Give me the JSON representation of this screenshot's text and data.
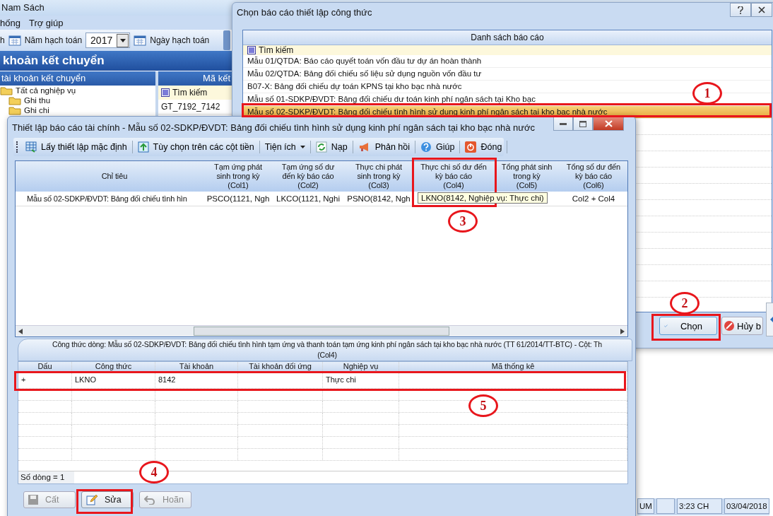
{
  "app": {
    "title": "Nam Sách",
    "menu": [
      "hống",
      "Trợ giúp"
    ],
    "toolbar": {
      "first_label": "h",
      "year_label": "Năm hạch toán",
      "year_value": "2017",
      "date_label": "Ngày hạch toán"
    },
    "heading": "khoản kết chuyển",
    "tree_panel": {
      "title": "tài khoản kết chuyển",
      "items": [
        {
          "label": "Tất cả nghiệp vụ",
          "children": [
            {
              "label": "Ghi thu"
            },
            {
              "label": "Ghi chi"
            }
          ]
        }
      ]
    },
    "grid": {
      "column": "Mã kết",
      "search": "Tìm kiếm",
      "rows": [
        "GT_7192_7142"
      ]
    },
    "status_bar": [
      "UM",
      "3:23 CH",
      "03/04/2018"
    ]
  },
  "report_picker": {
    "title": "Chọn báo cáo thiết lập công thức",
    "list_header": "Danh sách báo cáo",
    "search": "Tìm kiếm",
    "items": [
      {
        "label": "Mẫu 01/QTDA: Báo cáo quyết toán vốn đầu tư dự án hoàn thành",
        "selected": false
      },
      {
        "label": "Mẫu 02/QTDA: Bảng đối chiếu số liệu sử dụng nguồn vốn đầu tư",
        "selected": false
      },
      {
        "label": "B07-X: Bảng đối chiếu dự toán KPNS tại kho bạc nhà nước",
        "selected": false
      },
      {
        "label": "Mẫu số 01-SDKP/ĐVDT: Bảng đối chiếu dư toán kinh phí ngân sách tại Kho bạc",
        "selected": false
      },
      {
        "label": "Mẫu số 02-SDKP/ĐVDT: Bảng đối chiếu tình hình sử dụng kinh phí ngân sách tại kho bạc nhà nước",
        "selected": true
      }
    ],
    "buttons": [
      {
        "label": "Chọn",
        "kind": "ok"
      },
      {
        "label": "Hủy b",
        "kind": "cancel"
      }
    ]
  },
  "setup_dialog": {
    "title": "Thiết lập báo cáo tài chính - Mẫu số 02-SDKP/ĐVDT: Bảng đối chiếu tình hình sử dụng kinh phí ngân sách tại kho bạc nhà nước",
    "toolbar": [
      {
        "label": "Lấy thiết lập mặc định",
        "kind": "default"
      },
      {
        "label": "Tùy chọn trên các cột tiền",
        "kind": "options"
      },
      {
        "label": "Tiện ích",
        "kind": "menu"
      },
      {
        "label": "Nạp",
        "kind": "reload"
      },
      {
        "label": "Phản hồi",
        "kind": "feedback"
      },
      {
        "label": "Giúp",
        "kind": "help"
      },
      {
        "label": "Đóng",
        "kind": "close"
      }
    ],
    "columns": [
      {
        "label": "Chỉ tiêu"
      },
      {
        "label": "Tạm ứng phát sinh trong kỳ",
        "code": "(Col1)"
      },
      {
        "label": "Tạm ứng số dư đến kỳ báo cáo",
        "code": "(Col2)"
      },
      {
        "label": "Thực chi phát sinh trong kỳ",
        "code": "(Col3)"
      },
      {
        "label": "Thực chi số dư đến kỳ báo cáo",
        "code": "(Col4)"
      },
      {
        "label": "Tổng phát sinh trong kỳ",
        "code": "(Col5)"
      },
      {
        "label": "Tổng số dư đến kỳ báo cáo",
        "code": "(Col6)"
      }
    ],
    "rows": [
      {
        "label": "Mẫu số 02-SDKP/ĐVDT: Bảng đối chiếu tình hìn",
        "values": [
          "PSCO(1121, Ngh",
          "LKCO(1121, Nghi",
          "PSNO(8142, Ngh"
        ],
        "tooltip": "LKNO(8142, Nghiệp vụ: Thực chi)",
        "total": "Col2 + Col4"
      }
    ],
    "formula": {
      "tab": "Công thức dòng: Mẫu số 02-SDKP/ĐVDT: Bảng đối chiếu tình hình tạm ứng và thanh toán tạm ứng kinh phí ngân sách tại kho bạc nhà nước (TT 61/2014/TT-BTC) - Cột: Th",
      "tab_line2": "(Col4)",
      "columns": [
        "Dấu",
        "Công thức",
        "Tài khoản",
        "Tài khoản đối ứng",
        "Nghiệp vụ",
        "Mã thống kê"
      ],
      "rows": [
        {
          "sign": "+",
          "formula": "LKNO",
          "account": "8142",
          "business": "Thực chi"
        }
      ],
      "footer": "Số dòng = 1"
    },
    "buttons": [
      {
        "label": "Cất",
        "kind": "save",
        "disabled": true
      },
      {
        "label": "Sửa",
        "kind": "edit",
        "disabled": false
      },
      {
        "label": "Hoãn",
        "kind": "undo",
        "disabled": true
      }
    ]
  },
  "annotations": [
    {
      "number": "1"
    },
    {
      "number": "2"
    },
    {
      "number": "3"
    },
    {
      "number": "4"
    },
    {
      "number": "5"
    }
  ]
}
